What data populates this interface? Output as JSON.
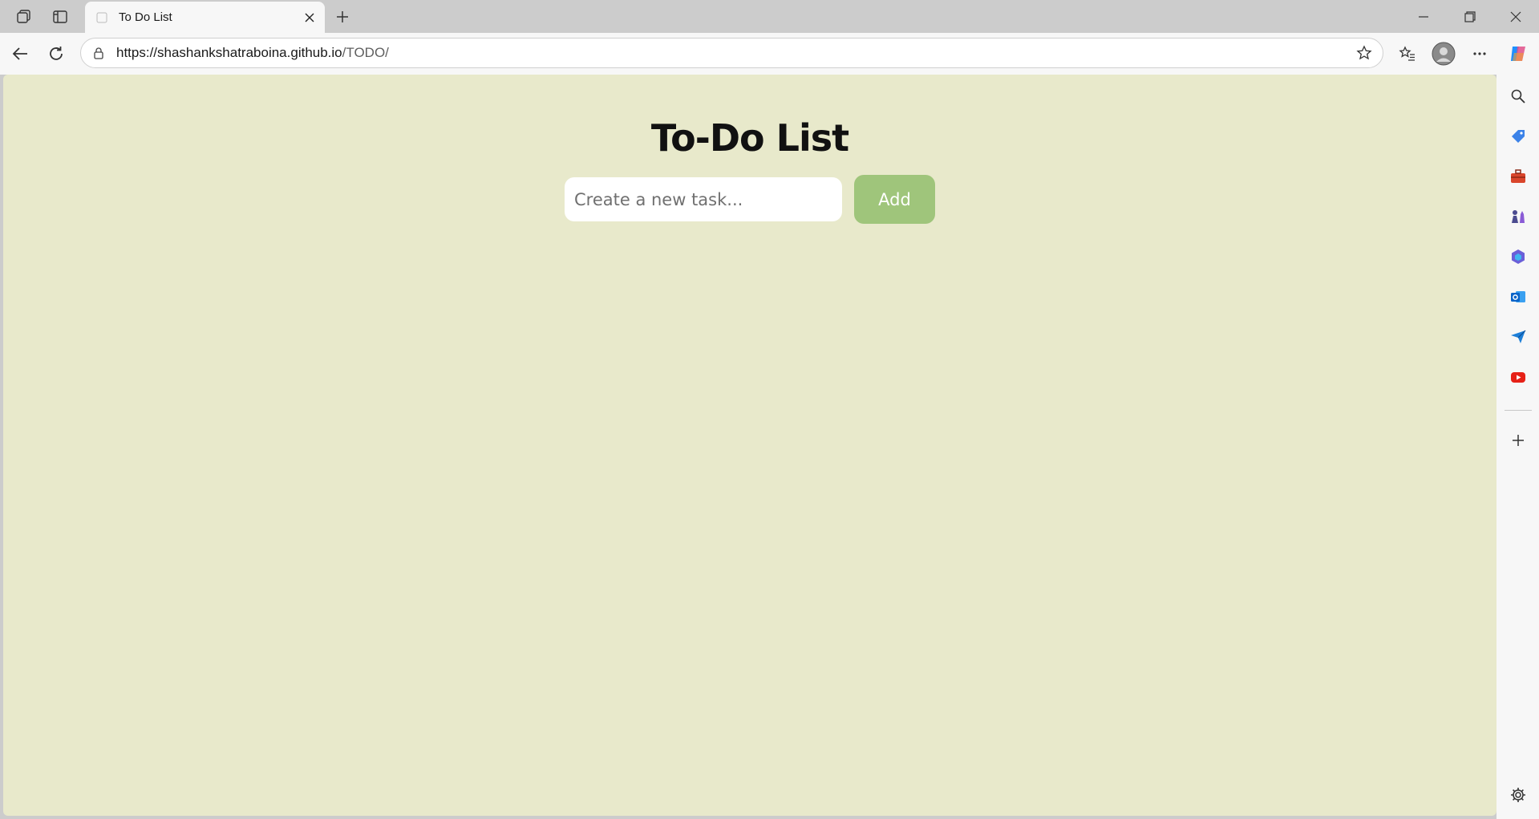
{
  "browser": {
    "tab": {
      "title": "To Do List"
    },
    "address": {
      "host_prefix": "https://shashankshatraboina.github.io",
      "path": "/TODO/"
    }
  },
  "page": {
    "title": "To-Do List",
    "input_placeholder": "Create a new task...",
    "input_value": "",
    "add_label": "Add",
    "colors": {
      "background": "#e8e9cb",
      "add_button": "#9fc57b"
    }
  },
  "sidebar": {
    "icons": [
      "search-icon",
      "shopping-tag-icon",
      "toolbox-icon",
      "chess-icon",
      "microsoft365-icon",
      "outlook-icon",
      "send-icon",
      "youtube-icon",
      "add-icon",
      "settings-icon"
    ]
  }
}
